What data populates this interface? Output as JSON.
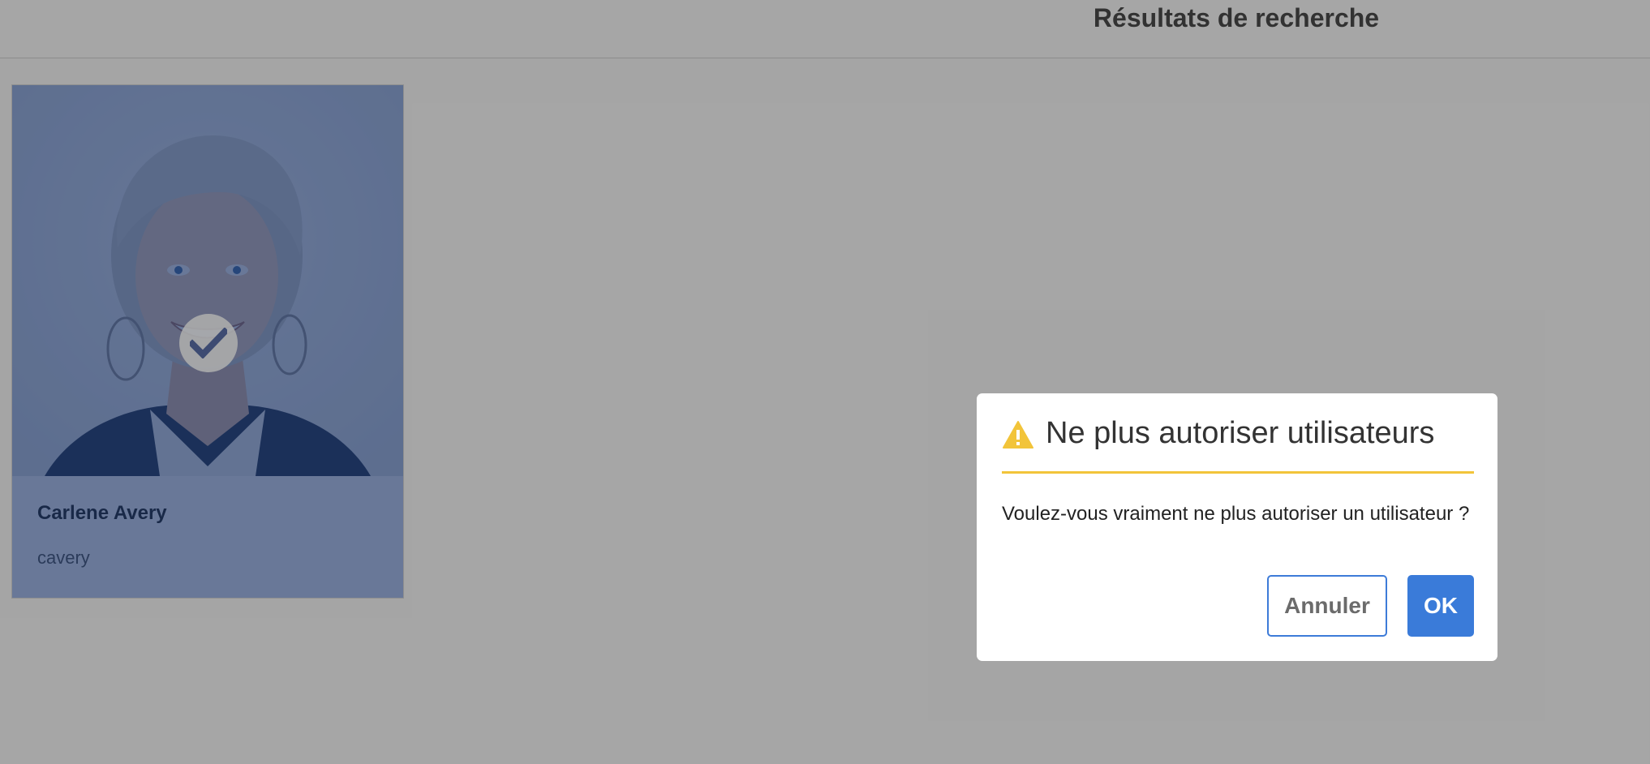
{
  "header": {
    "title": "Résultats de recherche"
  },
  "results": [
    {
      "name": "Carlene Avery",
      "login": "cavery",
      "selected": true
    }
  ],
  "dialog": {
    "title": "Ne plus autoriser utilisateurs",
    "message": "Voulez-vous vraiment ne plus autoriser un utilisateur ?",
    "cancel_label": "Annuler",
    "ok_label": "OK",
    "icon": "warning-icon"
  },
  "colors": {
    "accent": "#3a7bd9",
    "warning": "#f2c43a",
    "selection_tint": "#2254ba",
    "overlay": "#000000"
  }
}
